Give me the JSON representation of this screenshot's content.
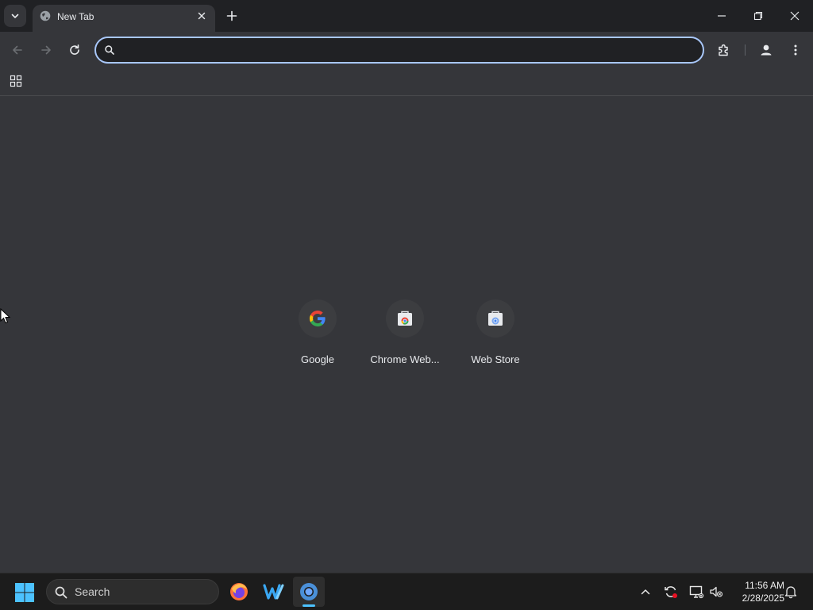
{
  "browser": {
    "tab": {
      "title": "New Tab"
    },
    "omnibox": {
      "value": "",
      "placeholder": ""
    }
  },
  "ntp": {
    "shortcuts": [
      {
        "label": "Google",
        "icon": "google-icon"
      },
      {
        "label": "Chrome Web...",
        "icon": "chrome-web-store-icon"
      },
      {
        "label": "Web Store",
        "icon": "web-store-icon"
      }
    ]
  },
  "taskbar": {
    "search_label": "Search",
    "apps": [
      "firefox-icon",
      "app-w-icon",
      "chrome-icon"
    ],
    "clock": {
      "time": "11:56 AM",
      "date": "2/28/2025"
    }
  },
  "colors": {
    "titlebar": "#202124",
    "toolbar": "#35363a",
    "omnibox_focus_ring": "#a8c7fa",
    "taskbar": "#1c1c1c",
    "active_indicator": "#4cc2ff"
  }
}
